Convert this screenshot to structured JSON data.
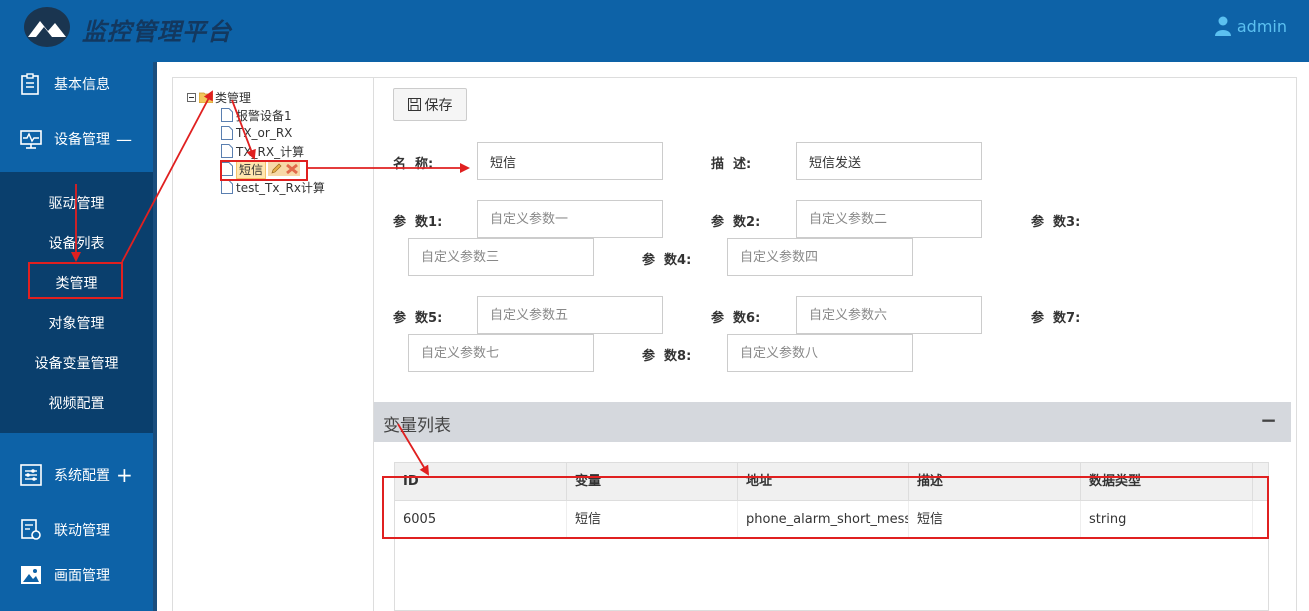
{
  "header": {
    "title": "监控管理平台",
    "user": "admin"
  },
  "sidebar": {
    "items": [
      {
        "label": "基本信息",
        "icon": "list-icon",
        "suffix": ""
      },
      {
        "label": "设备管理",
        "icon": "monitor-icon",
        "suffix": "—"
      },
      {
        "label": "系统配置",
        "icon": "sliders-icon",
        "suffix": "+"
      },
      {
        "label": "联动管理",
        "icon": "link-doc-icon",
        "suffix": ""
      },
      {
        "label": "画面管理",
        "icon": "image-icon",
        "suffix": ""
      }
    ],
    "submenu": [
      "驱动管理",
      "设备列表",
      "类管理",
      "对象管理",
      "设备变量管理",
      "视频配置"
    ]
  },
  "tree": {
    "root": "类管理",
    "children": [
      "报警设备1",
      "TX_or_RX",
      "TX_RX_计算",
      "短信",
      "test_Tx_Rx计算"
    ]
  },
  "form": {
    "save_label": "保存",
    "name_label": "名  称:",
    "name_value": "短信",
    "desc_label": "描  述:",
    "desc_value": "短信发送",
    "params": [
      {
        "label": "参  数1:",
        "placeholder": "自定义参数一"
      },
      {
        "label": "参  数2:",
        "placeholder": "自定义参数二"
      },
      {
        "label": "参  数3:",
        "placeholder": "自定义参数三"
      },
      {
        "label": "参  数4:",
        "placeholder": "自定义参数四"
      },
      {
        "label": "参  数5:",
        "placeholder": "自定义参数五"
      },
      {
        "label": "参  数6:",
        "placeholder": "自定义参数六"
      },
      {
        "label": "参  数7:",
        "placeholder": "自定义参数七"
      },
      {
        "label": "参  数8:",
        "placeholder": "自定义参数八"
      }
    ]
  },
  "variables": {
    "title": "变量列表",
    "collapse": "−",
    "columns": [
      "ID",
      "变量",
      "地址",
      "描述",
      "数据类型"
    ],
    "rows": [
      [
        "6005",
        "短信",
        "phone_alarm_short_mess",
        "短信",
        "string"
      ]
    ]
  },
  "colors": {
    "header_bg": "#0d62a7",
    "submenu_bg": "#0a3f6d",
    "annotation": "#e02020"
  }
}
